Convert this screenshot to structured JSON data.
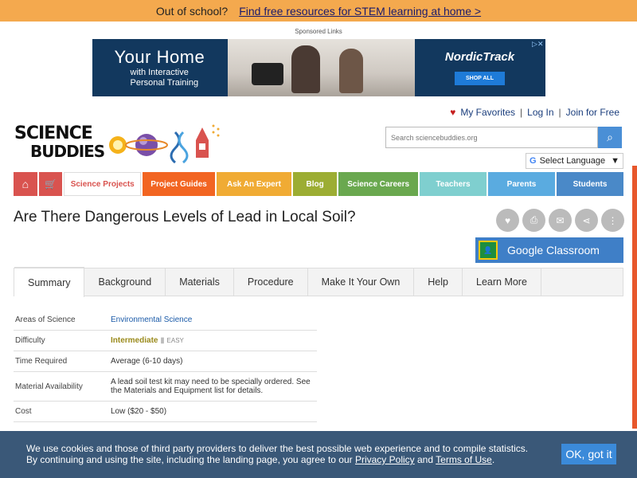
{
  "topbar": {
    "prefix": "Out of school?",
    "link": "Find free resources for STEM learning at home  >"
  },
  "ad": {
    "label": "Sponsored Links",
    "title": "Your Home",
    "sub_1": "with Interactive",
    "sub_2": "Personal Training",
    "brand": "NordicTrack",
    "cta": "SHOP ALL"
  },
  "utility": {
    "favorites": "My Favorites",
    "login": "Log In",
    "join": "Join for Free"
  },
  "logo": {
    "line1": "SCIENCE",
    "line2": "BUDDIES"
  },
  "search": {
    "placeholder": "Search sciencebuddies.org"
  },
  "language": {
    "label": "Select Language"
  },
  "nav": {
    "projects": "Science Projects",
    "guides": "Project Guides",
    "expert": "Ask An Expert",
    "blog": "Blog",
    "careers": "Science Careers",
    "teachers": "Teachers",
    "parents": "Parents",
    "students": "Students"
  },
  "page": {
    "title": "Are There Dangerous Levels of Lead in Local Soil?"
  },
  "classroom": {
    "label": "Google Classroom"
  },
  "tabs": [
    "Summary",
    "Background",
    "Materials",
    "Procedure",
    "Make It Your Own",
    "Help",
    "Learn More"
  ],
  "info": {
    "areas_label": "Areas of Science",
    "areas_value": "Environmental Science",
    "difficulty_label": "Difficulty",
    "difficulty_value": "Intermediate",
    "difficulty_sub": "EASY",
    "time_label": "Time Required",
    "time_value": "Average (6-10 days)",
    "material_label": "Material Availability",
    "material_value": "A lead soil test kit may need to be specially ordered. See the Materials and Equipment list for details.",
    "cost_label": "Cost",
    "cost_value": "Low ($20 - $50)"
  },
  "cookie": {
    "line1": "We use cookies and those of third party providers to deliver the best possible web experience and to compile statistics.",
    "line2": "By continuing and using the site, including the landing page, you agree to our",
    "privacy": "Privacy Policy",
    "and": "and",
    "terms": "Terms of Use",
    "button": "OK, got it"
  }
}
